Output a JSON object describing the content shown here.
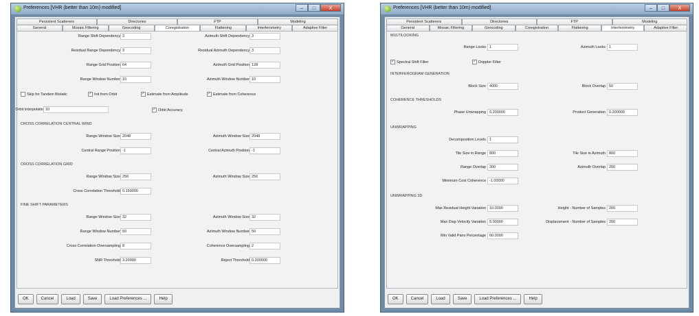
{
  "left_window": {
    "title": "Preferences [VHR (better than 10m) modified]",
    "title_buttons": [
      "–",
      "□",
      "X"
    ],
    "tabs_row1": [
      "Persistent Scatterers",
      "Directories",
      "FTP",
      "Modeling"
    ],
    "tabs_row2": [
      "General",
      "Mosaic Filtering",
      "Geocoding",
      "Coregistration",
      "Flattening",
      "Interferometry",
      "Adaptive Filter"
    ],
    "active_tab": "Coregistration",
    "fields": {
      "range_shift_dependency": {
        "label": "Range Shift Dependency",
        "value": "3"
      },
      "azimuth_shift_dependency": {
        "label": "Azimuth Shift Dependency",
        "value": "3"
      },
      "residual_range_dependency": {
        "label": "Residual Range Dependency",
        "value": "3"
      },
      "residual_azimuth_dependency": {
        "label": "Residual Azimuth Dependency",
        "value": "3"
      },
      "range_grid_position": {
        "label": "Range Grid Position",
        "value": "64"
      },
      "azimuth_grid_position": {
        "label": "Azimuth Grid Position",
        "value": "128"
      },
      "range_window_number": {
        "label": "Range Window Number",
        "value": "10"
      },
      "azimuth_window_number": {
        "label": "Azimuth Window Number",
        "value": "10"
      },
      "orbit_interpolation": {
        "label": "Orbit Interpolation",
        "value": "10"
      },
      "cccw_range_window_size": {
        "label": "Range Window Size",
        "value": "2048"
      },
      "cccw_azimuth_window_size": {
        "label": "Azimuth Window Size",
        "value": "2048"
      },
      "central_range_position": {
        "label": "Central Range Position",
        "value": "-1"
      },
      "central_azimuth_position": {
        "label": "Central Azimuth Position",
        "value": "-1"
      },
      "ccg_range_window_size": {
        "label": "Range Window Size",
        "value": "256"
      },
      "ccg_azimuth_window_size": {
        "label": "Azimuth Window Size",
        "value": "256"
      },
      "cross_correlation_threshold": {
        "label": "Cross Correlation Threshold",
        "value": "0.150000"
      },
      "fsp_range_window_size": {
        "label": "Range Window Size",
        "value": "32"
      },
      "fsp_azimuth_window_size": {
        "label": "Azimuth Window Size",
        "value": "32"
      },
      "fsp_range_window_number": {
        "label": "Range Window Number",
        "value": "50"
      },
      "fsp_azimuth_window_number": {
        "label": "Azimuth Window Number",
        "value": "50"
      },
      "cross_correlation_oversampling": {
        "label": "Cross Correlation Oversampling",
        "value": "8"
      },
      "coherence_oversampling": {
        "label": "Coherence Oversampling",
        "value": "2"
      },
      "snr_threshold": {
        "label": "SNR Threshold",
        "value": "3.20000"
      },
      "reject_threshold": {
        "label": "Reject Threshold",
        "value": "0.200000"
      }
    },
    "checkboxes": {
      "skip_tandem": {
        "label": "Skip for Tandem Bistatic",
        "checked": false
      },
      "init_from_orbit": {
        "label": "Init from Orbit",
        "checked": true
      },
      "estimate_amplitude": {
        "label": "Estimate from Amplitude",
        "checked": true
      },
      "estimate_coherence": {
        "label": "Estimate from Coherence",
        "checked": true
      },
      "orbit_accuracy": {
        "label": "Orbit Accuracy",
        "checked": true
      }
    },
    "sections": {
      "central_wind": "CROSS CORRELATION CENTRAL WIND",
      "grid": "CROSS CORRELATION GRID",
      "fine_shift": "FINE SHIFT PARAMETERS"
    }
  },
  "right_window": {
    "title": "Preferences [VHR (better than 10m) modified]",
    "title_buttons": [
      "–",
      "□",
      "X"
    ],
    "tabs_row1": [
      "Persistent Scatterers",
      "Directories",
      "FTP",
      "Modeling"
    ],
    "tabs_row2": [
      "General",
      "Mosaic Filtering",
      "Geocoding",
      "Coregistration",
      "Flattening",
      "Interferometry",
      "Adaptive Filter"
    ],
    "active_tab": "Interferometry",
    "sections": {
      "multilooking": "MULTILOOKING",
      "interferogram_generation": "INTERFEROGRAM GENERATION",
      "coherence_thresholds": "COHERENCE THRESHOLDS",
      "unwrapping": "UNWRAPPING",
      "unwrapping_3d": "UNWRAPPING 3D"
    },
    "fields": {
      "range_looks": {
        "label": "Range Looks",
        "value": "1"
      },
      "azimuth_looks": {
        "label": "Azimuth Looks",
        "value": "1"
      },
      "block_size": {
        "label": "Block Size",
        "value": "4000"
      },
      "block_overlap": {
        "label": "Block Overlap",
        "value": "50"
      },
      "phase_unwrapping": {
        "label": "Phase Unwrapping",
        "value": "0.200000"
      },
      "product_generation": {
        "label": "Product Generation",
        "value": "0.200000"
      },
      "decomposition_levels": {
        "label": "Decomposition Levels",
        "value": "1"
      },
      "tile_size_range": {
        "label": "Tile Size in Range",
        "value": "800"
      },
      "tile_size_azimuth": {
        "label": "Tile Size in Azimuth",
        "value": "800"
      },
      "range_overlap": {
        "label": "Range Overlap",
        "value": "300"
      },
      "azimuth_overlap": {
        "label": "Azimuth Overlap",
        "value": "200"
      },
      "minimum_cost_coherence": {
        "label": "Minimum Cost Coherence",
        "value": "-1.00000"
      },
      "max_residual_height": {
        "label": "Max Residual Height Variation",
        "value": "10.0000"
      },
      "height_samples": {
        "label": "Height - Number of Samples",
        "value": "200"
      },
      "max_disp_velocity": {
        "label": "Max Disp Velocity Variation",
        "value": "5.00000"
      },
      "displacement_samples": {
        "label": "Displacement - Number of Samples",
        "value": "200"
      },
      "min_valid_pairs": {
        "label": "Min Valid Pairs Percentage",
        "value": "60.0000"
      }
    },
    "checkboxes": {
      "spectral_shift": {
        "label": "Spectral Shift Filter",
        "checked": true
      },
      "doppler_filter": {
        "label": "Doppler Filter",
        "checked": true
      }
    }
  },
  "buttons": [
    "OK",
    "Cancel",
    "Load",
    "Save",
    "Load Preferences ...",
    "Help"
  ],
  "colors": {
    "title_bar": "#9db7d0",
    "close_button": "#c2412b",
    "panel": "#f2f2f2"
  }
}
